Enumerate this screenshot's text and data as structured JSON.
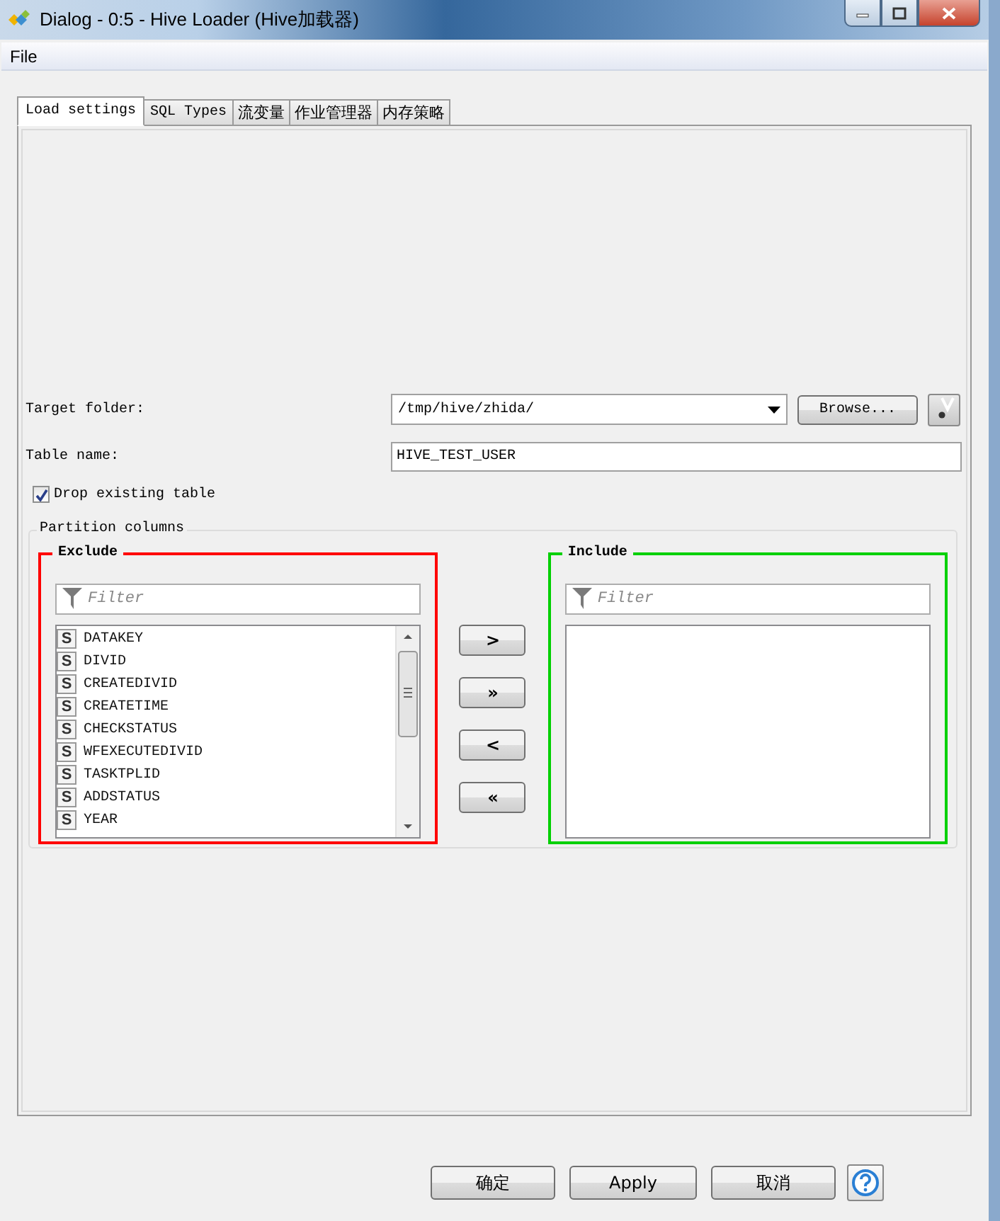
{
  "window": {
    "title": "Dialog - 0:5 - Hive Loader (Hive加载器)"
  },
  "menu": [
    "File"
  ],
  "tabs": [
    {
      "label": "Load settings",
      "selected": true
    },
    {
      "label": "SQL Types",
      "selected": false
    },
    {
      "label": "流变量",
      "selected": false
    },
    {
      "label": "作业管理器",
      "selected": false
    },
    {
      "label": "内存策略",
      "selected": false
    }
  ],
  "target_folder": {
    "label": "Target folder:",
    "value": "/tmp/hive/zhida/"
  },
  "browse_button": "Browse...",
  "table_name": {
    "label": "Table name:",
    "value": "HIVE_TEST_USER"
  },
  "drop_existing": {
    "label": "Drop existing table",
    "checked": true
  },
  "partition": {
    "title": "Partition columns",
    "exclude": {
      "title": "Exclude",
      "color": "#ff0000",
      "placeholder": "Filter",
      "items": [
        {
          "badge": "S",
          "name": "DATAKEY"
        },
        {
          "badge": "S",
          "name": "DIVID"
        },
        {
          "badge": "S",
          "name": "CREATEDIVID"
        },
        {
          "badge": "S",
          "name": "CREATETIME"
        },
        {
          "badge": "S",
          "name": "CHECKSTATUS"
        },
        {
          "badge": "S",
          "name": "WFEXECUTEDIVID"
        },
        {
          "badge": "S",
          "name": "TASKTPLID"
        },
        {
          "badge": "S",
          "name": "ADDSTATUS"
        },
        {
          "badge": "S",
          "name": "YEAR"
        }
      ]
    },
    "move_buttons": [
      ">",
      "»",
      "<",
      "«"
    ],
    "include": {
      "title": "Include",
      "color": "#00d000",
      "placeholder": "Filter"
    }
  },
  "footer_buttons": [
    "确定",
    "Apply",
    "取消"
  ]
}
